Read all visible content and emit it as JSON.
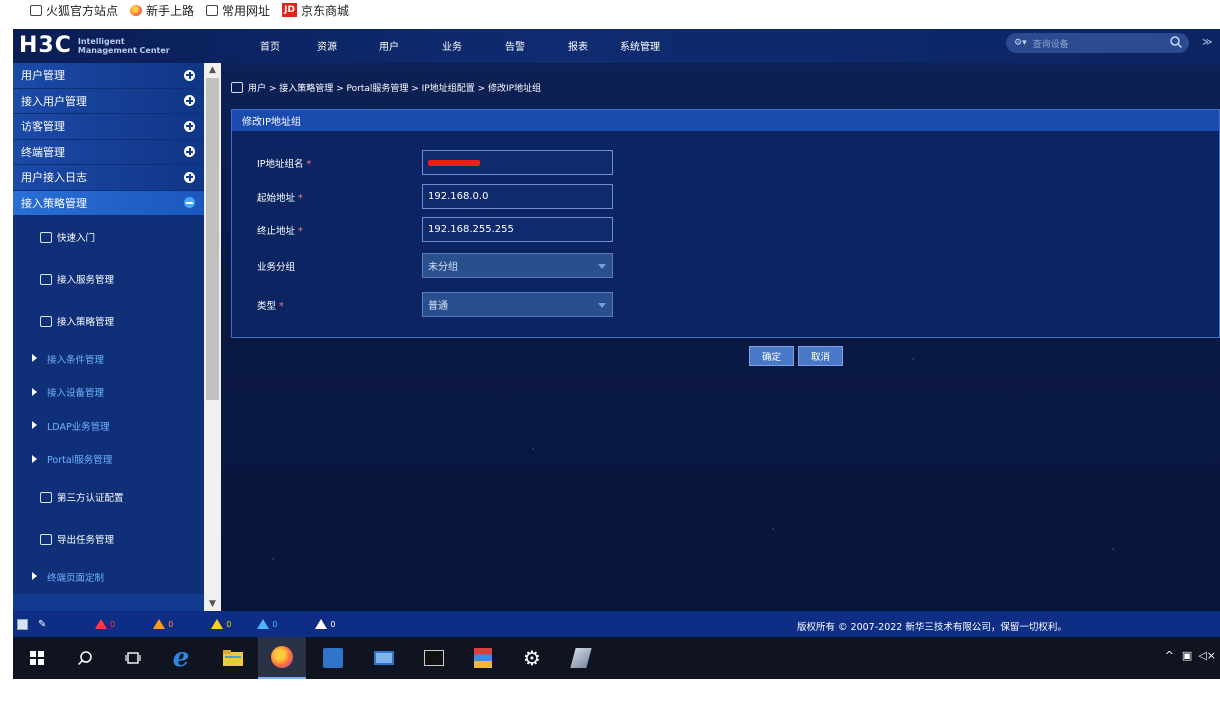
{
  "bookmarks": [
    {
      "label": "火狐官方站点",
      "icon": "folder-icon"
    },
    {
      "label": "新手上路",
      "icon": "firefox-icon"
    },
    {
      "label": "常用网址",
      "icon": "folder-icon"
    },
    {
      "label": "京东商城",
      "icon": "jd-icon",
      "icon_text": "JD"
    }
  ],
  "header": {
    "logo": "H3C",
    "logo_sub_1": "Intelligent",
    "logo_sub_2": "Management Center",
    "nav": [
      "首页",
      "资源",
      "用户",
      "业务",
      "告警",
      "报表",
      "系统管理"
    ],
    "search_placeholder": "查询设备"
  },
  "sidebar": {
    "groups": [
      {
        "label": "用户管理",
        "state": "plus"
      },
      {
        "label": "接入用户管理",
        "state": "plus"
      },
      {
        "label": "访客管理",
        "state": "plus"
      },
      {
        "label": "终端管理",
        "state": "plus"
      },
      {
        "label": "用户接入日志",
        "state": "plus"
      },
      {
        "label": "接入策略管理",
        "state": "minus"
      }
    ],
    "items": [
      {
        "label": "快速入门",
        "type": "icon"
      },
      {
        "label": "接入服务管理",
        "type": "icon"
      },
      {
        "label": "接入策略管理",
        "type": "icon"
      },
      {
        "label": "接入条件管理",
        "type": "expand"
      },
      {
        "label": "接入设备管理",
        "type": "expand"
      },
      {
        "label": "LDAP业务管理",
        "type": "expand"
      },
      {
        "label": "Portal服务管理",
        "type": "expand"
      },
      {
        "label": "第三方认证配置",
        "type": "icon"
      },
      {
        "label": "导出任务管理",
        "type": "icon"
      },
      {
        "label": "终端页面定制",
        "type": "expand"
      }
    ]
  },
  "breadcrumb": "用户 > 接入策略管理 > Portal服务管理 > IP地址组配置 > 修改IP地址组",
  "form": {
    "title": "修改IP地址组",
    "fields": [
      {
        "label": "IP地址组名",
        "required": true,
        "value": "",
        "redacted": true
      },
      {
        "label": "起始地址",
        "required": true,
        "value": "192.168.0.0"
      },
      {
        "label": "终止地址",
        "required": true,
        "value": "192.168.255.255"
      },
      {
        "label": "业务分组",
        "required": false,
        "value": "未分组",
        "select": true
      },
      {
        "label": "类型",
        "required": true,
        "value": "普通",
        "select": true
      }
    ],
    "required_mark": "*",
    "ok_label": "确定",
    "cancel_label": "取消"
  },
  "statusbar": {
    "alarm_counts": [
      "0",
      "0",
      "0",
      "0",
      "0"
    ],
    "alarm_colors": [
      "#ff3b3b",
      "#ff9a1a",
      "#ffd21a",
      "#4fb4ff",
      "#ffffff"
    ],
    "copyright": "版权所有 © 2007-2022 新华三技术有限公司，保留一切权利。"
  }
}
